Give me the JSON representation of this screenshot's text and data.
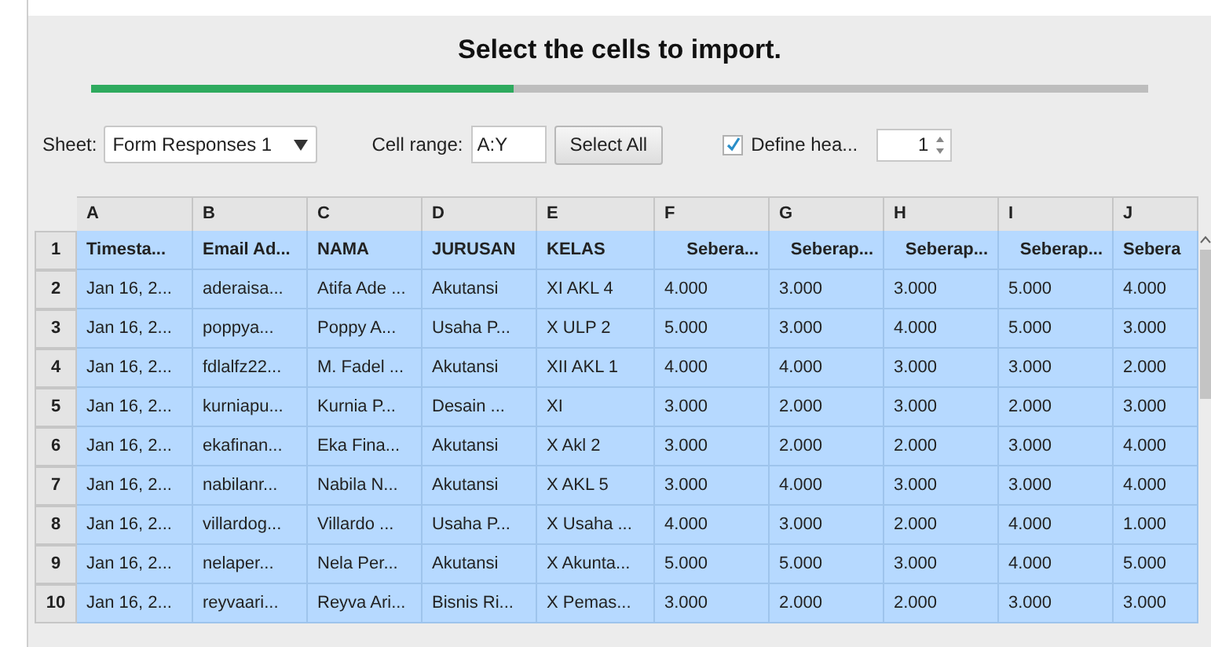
{
  "dialog": {
    "title": "Select the cells to import.",
    "progress": {
      "level": 0.4
    }
  },
  "controls": {
    "sheet_label": "Sheet:",
    "sheet_value": "Form Responses 1",
    "range_label": "Cell range:",
    "range_value": "A:Y",
    "select_all": "Select All",
    "define_header": {
      "label": "Define hea...",
      "checked": true
    },
    "header_rows": "1"
  },
  "table": {
    "columns": [
      "A",
      "B",
      "C",
      "D",
      "E",
      "F",
      "G",
      "H",
      "I",
      "J"
    ],
    "rows": [
      {
        "number": "1",
        "selected": true,
        "header": true,
        "cells": [
          "Timesta...",
          "Email Ad...",
          "NAMA",
          "JURUSAN",
          "KELAS",
          "Sebera...",
          "Seberap...",
          "Seberap...",
          "Seberap...",
          "Sebera"
        ]
      },
      {
        "number": "2",
        "selected": true,
        "header": false,
        "cells": [
          "Jan 16, 2...",
          "aderaisa...",
          "Atifa Ade ...",
          "Akutansi",
          "XI AKL 4",
          "4.000",
          "3.000",
          "3.000",
          "5.000",
          "4.000"
        ]
      },
      {
        "number": "3",
        "selected": true,
        "header": false,
        "cells": [
          "Jan 16, 2...",
          "poppya...",
          "Poppy A...",
          "Usaha P...",
          "X ULP 2",
          "5.000",
          "3.000",
          "4.000",
          "5.000",
          "3.000"
        ]
      },
      {
        "number": "4",
        "selected": true,
        "header": false,
        "cells": [
          "Jan 16, 2...",
          "fdlalfz22...",
          "M. Fadel ...",
          "Akutansi",
          "XII AKL 1",
          "4.000",
          "4.000",
          "3.000",
          "3.000",
          "2.000"
        ]
      },
      {
        "number": "5",
        "selected": true,
        "header": false,
        "cells": [
          "Jan 16, 2...",
          "kurniapu...",
          "Kurnia P...",
          "Desain ...",
          "XI",
          "3.000",
          "2.000",
          "3.000",
          "2.000",
          "3.000"
        ]
      },
      {
        "number": "6",
        "selected": true,
        "header": false,
        "cells": [
          "Jan 16, 2...",
          "ekafinan...",
          "Eka Fina...",
          "Akutansi",
          "X Akl 2",
          "3.000",
          "2.000",
          "2.000",
          "3.000",
          "4.000"
        ]
      },
      {
        "number": "7",
        "selected": true,
        "header": false,
        "cells": [
          "Jan 16, 2...",
          "nabilanr...",
          "Nabila N...",
          "Akutansi",
          "X AKL 5",
          "3.000",
          "4.000",
          "3.000",
          "3.000",
          "4.000"
        ]
      },
      {
        "number": "8",
        "selected": true,
        "header": false,
        "cells": [
          "Jan 16, 2...",
          "villardog...",
          "Villardo ...",
          "Usaha P...",
          "X Usaha ...",
          "4.000",
          "3.000",
          "2.000",
          "4.000",
          "1.000"
        ]
      },
      {
        "number": "9",
        "selected": true,
        "header": false,
        "cells": [
          "Jan 16, 2...",
          "nelaper...",
          "Nela Per...",
          "Akutansi",
          "X Akunta...",
          "5.000",
          "5.000",
          "3.000",
          "4.000",
          "5.000"
        ]
      },
      {
        "number": "10",
        "selected": true,
        "header": false,
        "cells": [
          "Jan 16, 2...",
          "reyvaari...",
          "Reyva Ari...",
          "Bisnis Ri...",
          "X Pemas...",
          "3.000",
          "2.000",
          "2.000",
          "3.000",
          "3.000"
        ]
      }
    ]
  }
}
